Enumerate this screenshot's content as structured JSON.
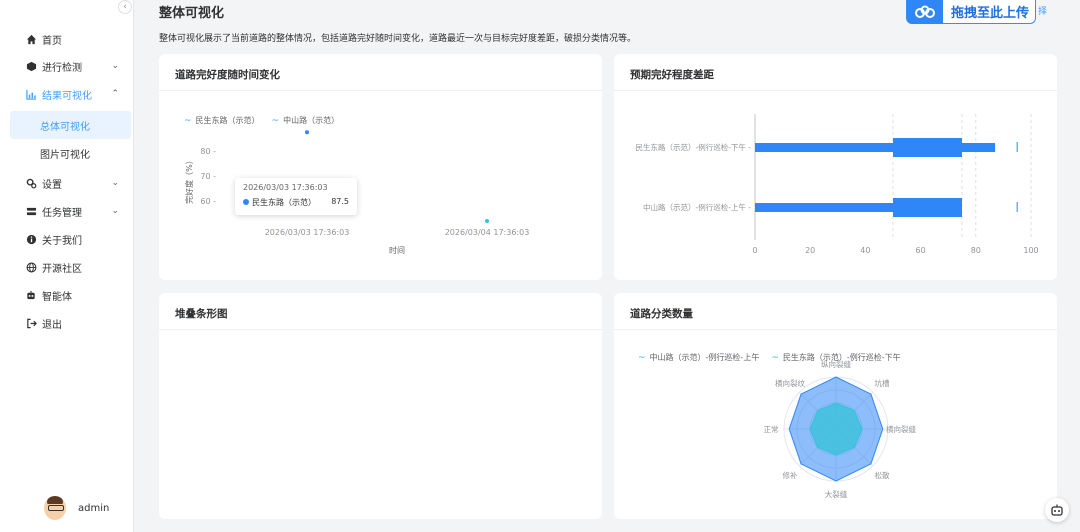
{
  "sidebar": {
    "collapse_icon": "chevron-left-icon",
    "items": [
      {
        "label": "首页",
        "icon": "home-icon"
      },
      {
        "label": "进行检测",
        "icon": "detect-icon"
      },
      {
        "label": "结果可视化",
        "icon": "chart-icon"
      },
      {
        "label": "总体可视化"
      },
      {
        "label": "图片可视化"
      },
      {
        "label": "设置",
        "icon": "gear-icon"
      },
      {
        "label": "任务管理",
        "icon": "task-icon"
      },
      {
        "label": "关于我们",
        "icon": "info-icon"
      },
      {
        "label": "开源社区",
        "icon": "globe-icon"
      },
      {
        "label": "智能体",
        "icon": "robot-icon"
      },
      {
        "label": "退出",
        "icon": "logout-icon"
      }
    ],
    "user": {
      "name": "admin"
    }
  },
  "header": {
    "title": "整体可视化",
    "description": "整体可视化展示了当前道路的整体情况，包括道路完好随时间变化，道路最近一次与目标完好度差距，破损分类情况等。",
    "upload_label": "拖拽至此上传",
    "select_label": "择"
  },
  "cards": {
    "line": {
      "title": "道路完好度随时间变化"
    },
    "gap": {
      "title": "预期完好程度差距"
    },
    "stacked": {
      "title": "堆叠条形图"
    },
    "radar": {
      "title": "道路分类数量"
    }
  },
  "tooltip": {
    "time": "2026/03/03 17:36:03",
    "series": "民生东路（示范）",
    "value": "87.5"
  },
  "colors": {
    "accent": "#409eff",
    "series_blue": "#2f86f6",
    "series_cyan": "#35c3d8"
  },
  "chart_data": [
    {
      "type": "scatter",
      "legend": [
        "民生东路（示范）",
        "中山路（示范）"
      ],
      "xlabel": "时间",
      "ylabel": "完好度（%）",
      "yticks": [
        60,
        70,
        80
      ],
      "x_categories": [
        "2026/03/03 17:36:03",
        "2026/03/04 17:36:03"
      ],
      "series": [
        {
          "name": "民生东路（示范）",
          "points": [
            {
              "x": "2026/03/03 17:36:03",
              "y": 87.5
            }
          ]
        },
        {
          "name": "中山路（示范）",
          "points": [
            {
              "x": "2026/03/04 17:36:03",
              "y": 52
            }
          ]
        }
      ]
    },
    {
      "type": "bar",
      "orientation": "horizontal",
      "categories": [
        "民生东路（示范）-例行巡检-下午",
        "中山路（示范）-例行巡检-上午"
      ],
      "xticks": [
        0,
        20,
        40,
        60,
        80,
        100
      ],
      "xlim": [
        0,
        100
      ],
      "series": [
        {
          "values": [
            87,
            75
          ]
        },
        {
          "values": [
            75,
            75
          ]
        }
      ],
      "band_range": [
        50,
        75
      ],
      "target_markers": [
        95,
        95
      ],
      "vlines": [
        50,
        75,
        80,
        100
      ]
    },
    {
      "type": "radar",
      "legend": [
        "中山路（示范）-例行巡检-上午",
        "民生东路（示范）-例行巡检-下午"
      ],
      "indicators": [
        "纵向裂缝",
        "坑槽",
        "横向裂缝",
        "松散",
        "大裂缝",
        "修补",
        "正常",
        "横向裂纹"
      ],
      "series": [
        {
          "name": "中山路（示范）-例行巡检-上午",
          "values": [
            0.5,
            0.5,
            0.5,
            0.5,
            0.5,
            0.5,
            0.5,
            0.5
          ]
        },
        {
          "name": "民生东路（示范）-例行巡检-下午",
          "values": [
            1,
            0.95,
            0.9,
            0.95,
            1,
            0.95,
            0.9,
            0.95
          ]
        }
      ]
    }
  ]
}
